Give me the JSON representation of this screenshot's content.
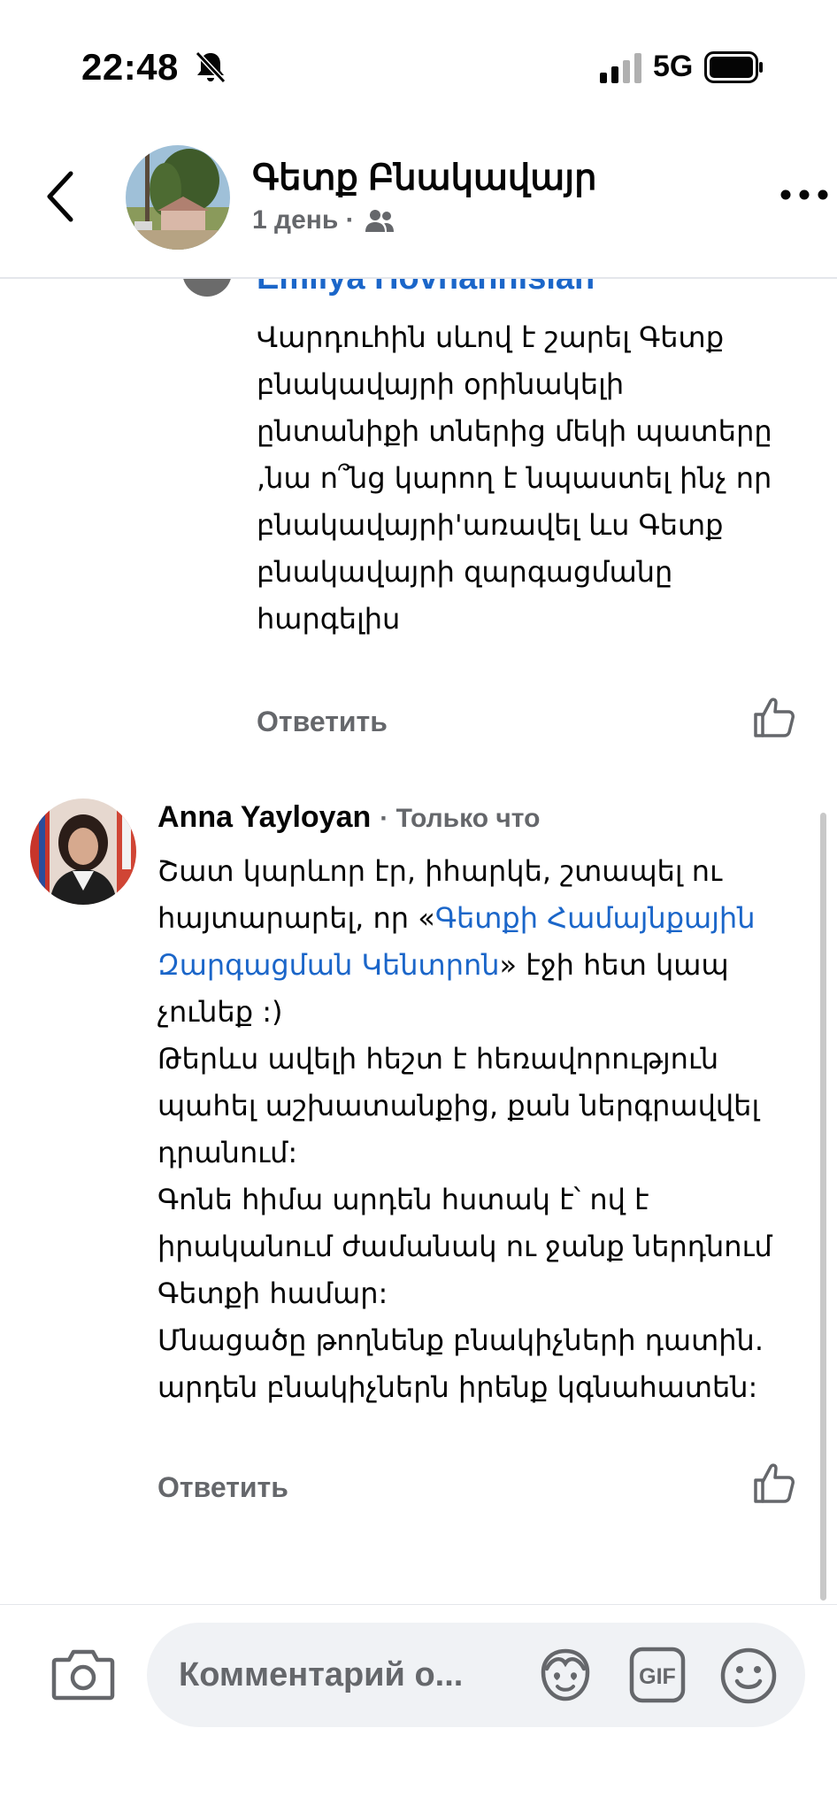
{
  "status_bar": {
    "time": "22:48",
    "network": "5G",
    "icons": [
      "bell-slash-icon",
      "signal-icon",
      "battery-icon"
    ]
  },
  "header": {
    "title": "Գետք Բնակավայր",
    "meta": "1 день ·",
    "icons": [
      "back-icon",
      "group-audience-icon",
      "more-icon"
    ]
  },
  "previous_comment": {
    "author": "Emilya Hovhannisian",
    "body": "Վարդուհին սևով է շարել Գետք բնակավայրի օրինակելի ընտանիքի տներից մեկի պատերը ,նա ո՞նց կարող է նպաստել ինչ որ բնակավայրի'առավել ևս Գետք բնակավայրի  զարգացմանը հարգելիս",
    "reply_label": "Ответить"
  },
  "main_comment": {
    "author": "Anna Yayloyan",
    "time": "· Только что",
    "body_part1": "Շատ կարևոր էր, իհարկե, շտապել ու հայտարարել, որ «",
    "mention": "Գետքի Համայնքային Զարգացման Կենտրոն",
    "body_part2": "» էջի հետ կապ չունեք :)",
    "body_part3": "Թերևս ավելի հեշտ է հեռավորություն պահել աշխատանքից, քան ներգրավվել դրանում:",
    "body_part4": "Գոնե հիմա արդեն հստակ է՝ ով է իրականում ժամանակ ու ջանք ներդնում Գետքի համար:",
    "body_part5": "Մնացածը թողնենք բնակիչների դատին. արդեն բնակիչներն իրենք կգնահատեն:",
    "reply_label": "Ответить"
  },
  "composer": {
    "placeholder": "Комментарий о...",
    "icons": [
      "camera-icon",
      "avatar-sticker-icon",
      "gif-icon",
      "emoji-icon"
    ],
    "gif_label": "GIF"
  },
  "colors": {
    "link": "#1b66c9",
    "secondary_text": "#65676b",
    "composer_bg": "#f0f2f5"
  }
}
